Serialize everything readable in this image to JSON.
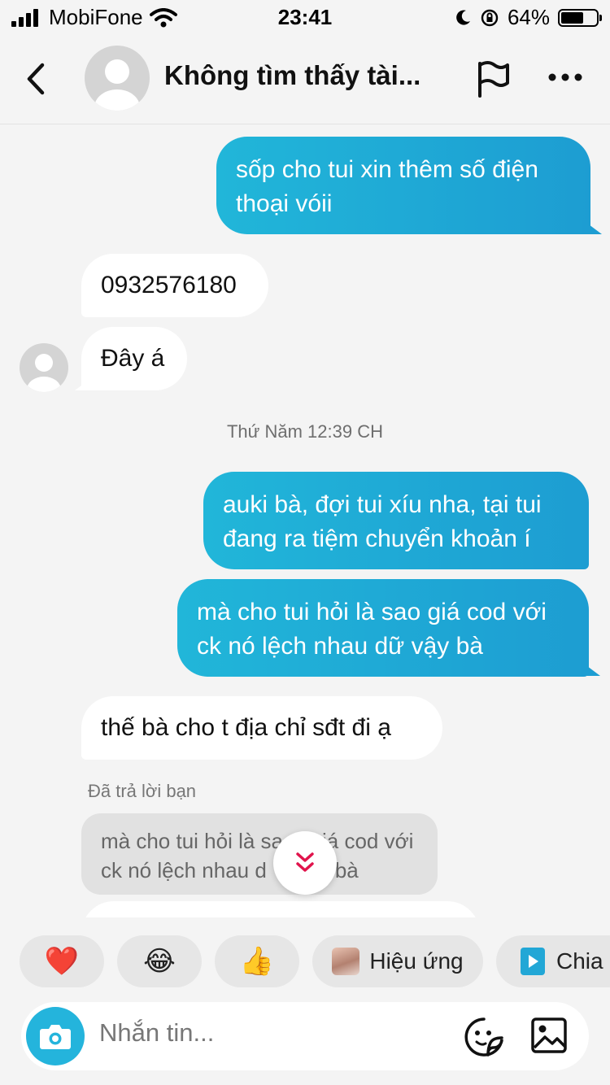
{
  "status_bar": {
    "carrier": "MobiFone",
    "time": "23:41",
    "battery": "64%",
    "battery_level": 0.64
  },
  "header": {
    "title": "Không tìm thấy tài..."
  },
  "messages": [
    {
      "dir": "out",
      "text": "sốp cho tui xin thêm số điện thoại vóii"
    },
    {
      "dir": "in",
      "text": "0932576180"
    },
    {
      "dir": "in",
      "text": "Đây á"
    },
    {
      "dir": "out",
      "text": "auki bà, đợi tui xíu nha, tại tui đang ra tiệm chuyển khoản í"
    },
    {
      "dir": "out",
      "text": "mà cho tui hỏi là sao giá cod với ck nó lệch nhau dữ vậy bà"
    },
    {
      "dir": "in",
      "text": "thế bà cho t địa chỉ sđt đi ạ"
    }
  ],
  "timestamp": "Thứ Năm 12:39 CH",
  "reply": {
    "label": "Đã trả lời bạn",
    "quote_line1": "mà cho tui hỏi là sa",
    "quote_line1b": "iá cod với",
    "quote_line2": "ck nó lệch nhau d",
    "quote_line2b": "bà"
  },
  "reactions": {
    "heart": "❤️",
    "laugh": "😂",
    "thumbs": "👍",
    "effects_label": "Hiệu ứng",
    "share_label": "Chia s"
  },
  "composer": {
    "placeholder": "Nhắn tin..."
  },
  "colors": {
    "outgoing": "#1fa9d6",
    "accent": "#24b4dc",
    "background": "#f4f4f4"
  }
}
